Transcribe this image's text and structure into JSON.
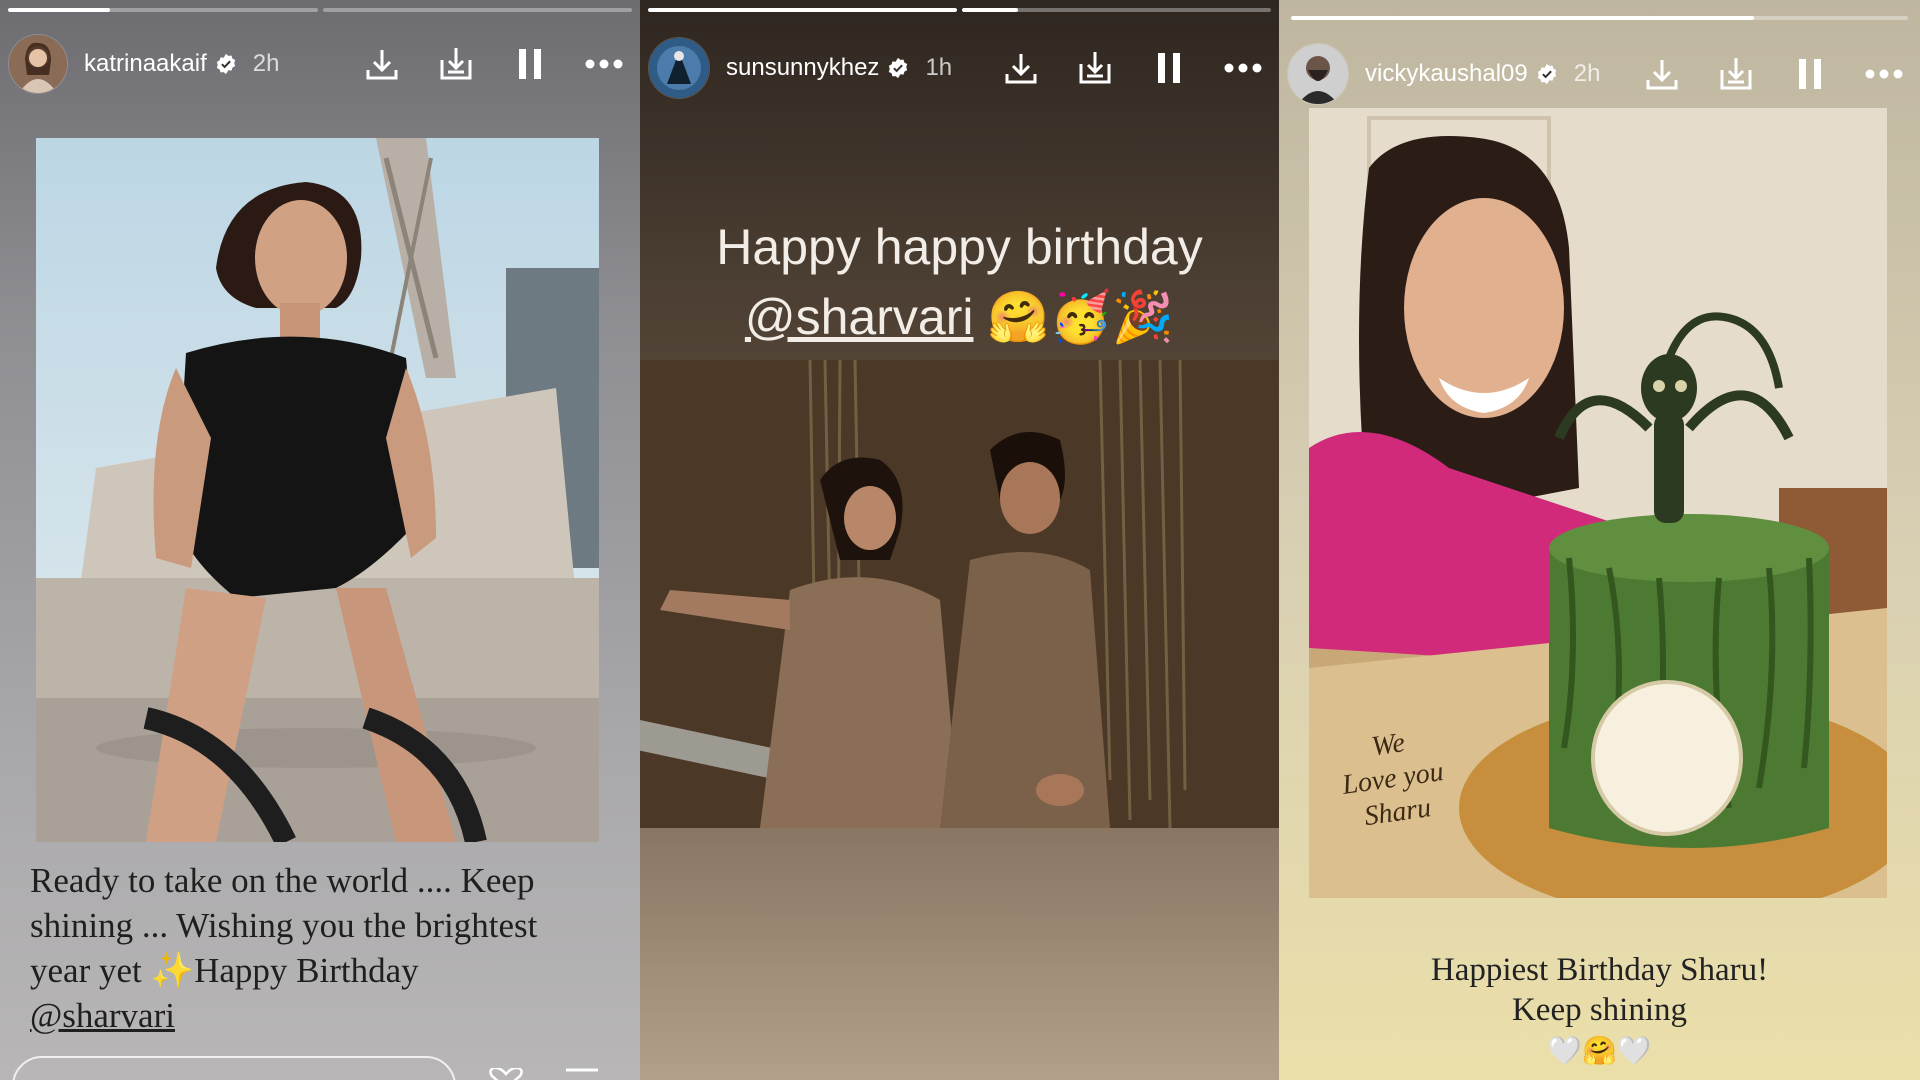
{
  "stories": [
    {
      "username": "katrinaakaif",
      "time": "2h",
      "caption": {
        "line1": "Ready to take on the world .... Keep",
        "line2": "shining ... Wishing you the brightest",
        "line3a": "year yet ",
        "sparkle": "✨",
        "line3b": "Happy Birthday",
        "mention": "@sharvari"
      },
      "progress": [
        0.33,
        0
      ]
    },
    {
      "username": "sunsunnykhez",
      "time": "1h",
      "caption": {
        "line1": "Happy happy birthday",
        "mention": "@sharvari",
        "emojis": "🤗🥳🎉"
      },
      "progress": [
        1,
        0.18
      ]
    },
    {
      "username": "vickykaushal09",
      "time": "2h",
      "caption": {
        "line1": "Happiest Birthday Sharu!",
        "line2": "Keep shining",
        "emojis": "🤍🤗🤍"
      },
      "cake_text": [
        "We",
        "Love you",
        "Sharu"
      ],
      "progress": [
        0.75
      ]
    }
  ],
  "colors": {
    "verified": "#ffffff",
    "progress_fill": "#ffffff",
    "cake_green": "#4d7a33"
  },
  "icons": [
    "download-icon",
    "save-to-device-icon",
    "pause-icon",
    "more-options-icon",
    "verified-badge-icon"
  ]
}
